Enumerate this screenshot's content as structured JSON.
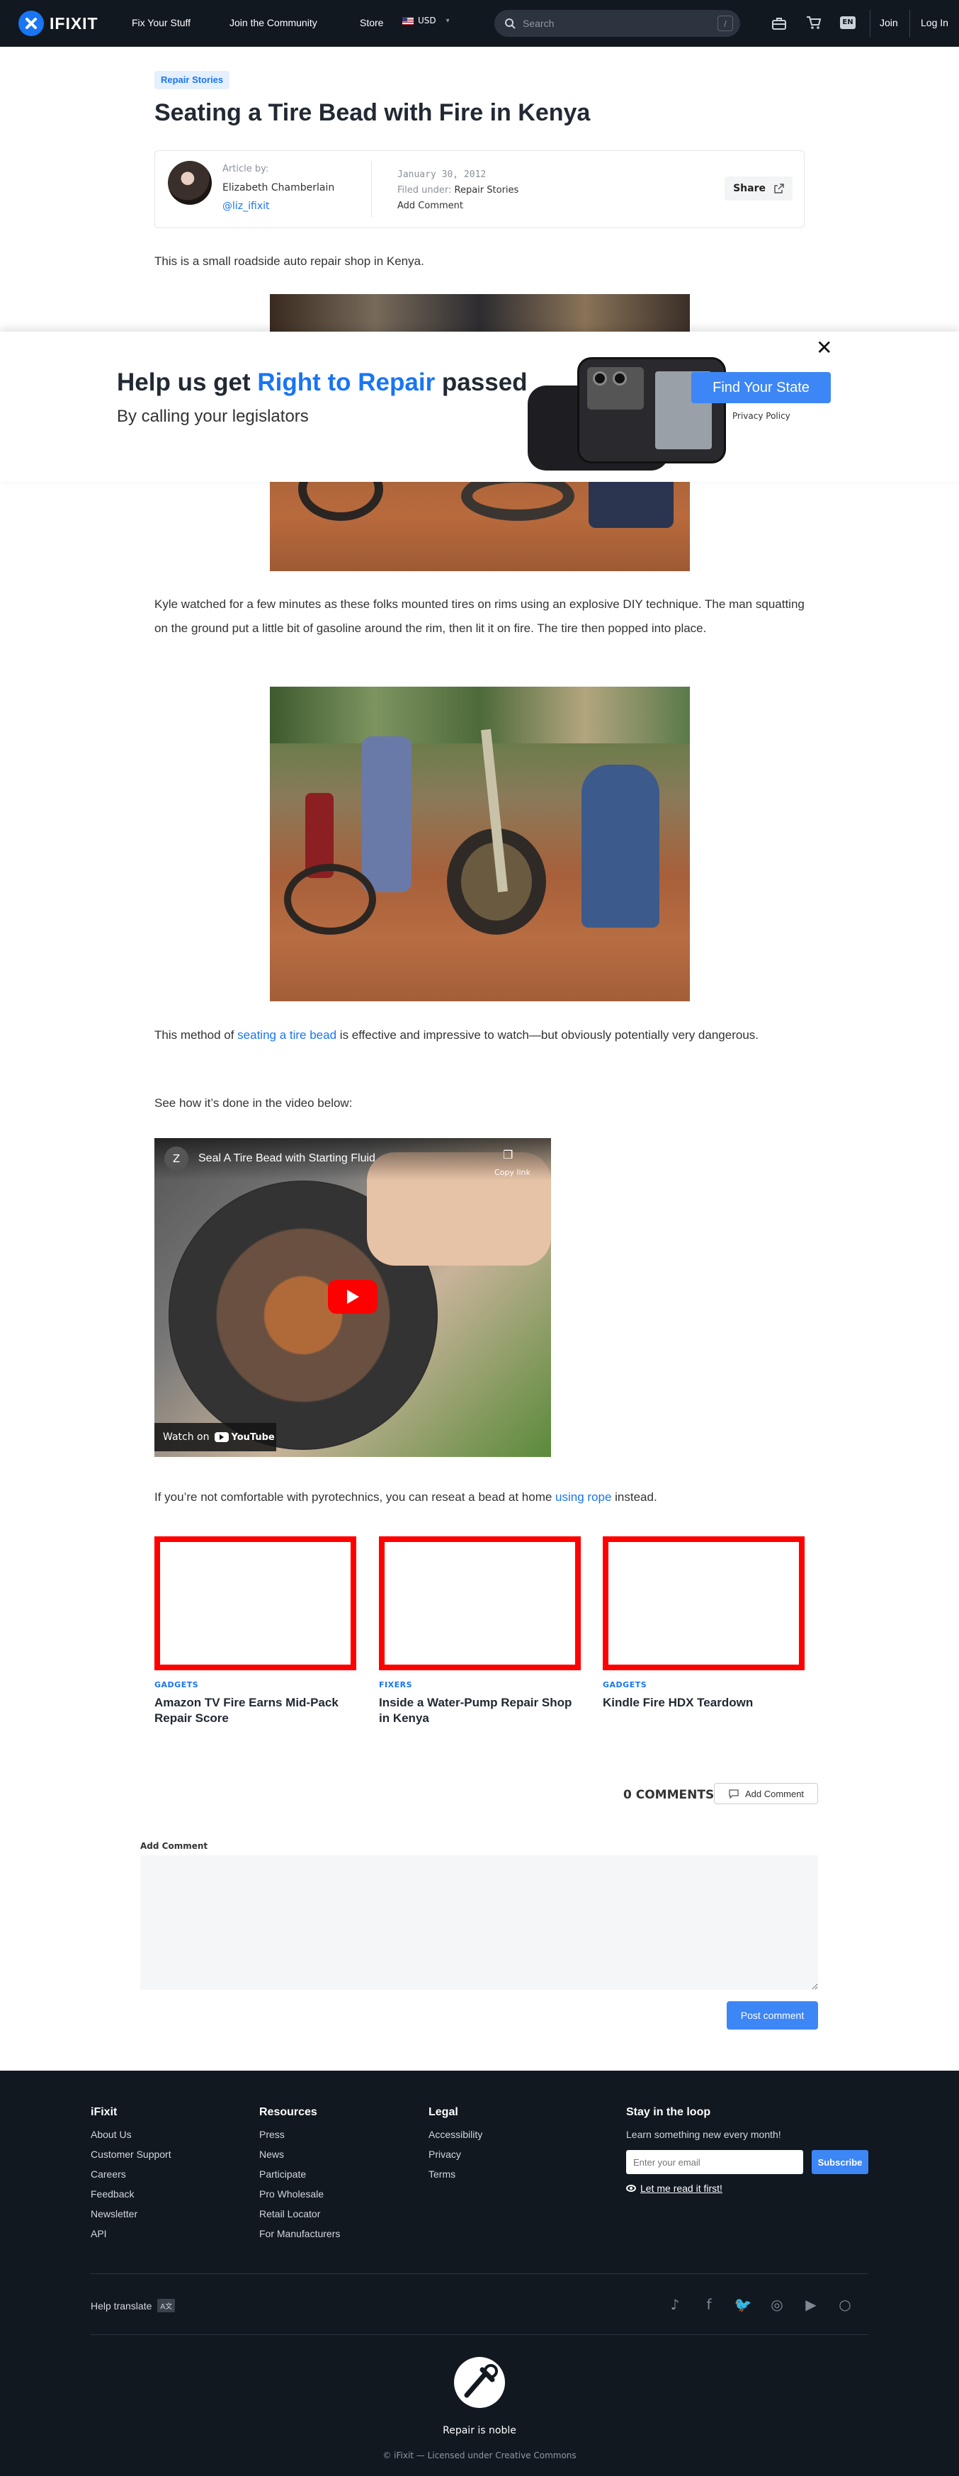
{
  "nav": {
    "brand": "IFIXIT",
    "links": [
      "Fix Your Stuff",
      "Join the Community",
      "Store"
    ],
    "currency": "USD",
    "search_placeholder": "Search",
    "search_shortcut": "/",
    "lang": "EN",
    "join": "Join",
    "login": "Log In"
  },
  "article": {
    "tag": "Repair Stories",
    "title": "Seating a Tire Bead with Fire in Kenya",
    "byline": {
      "article_by": "Article by:",
      "author": "Elizabeth Chamberlain",
      "handle": "@liz_ifixit",
      "date": "January 30, 2012",
      "filed_under_label": "Filed under:",
      "filed_under": "Repair Stories",
      "add_comment": "Add Comment",
      "share": "Share"
    },
    "p1": "This is a small roadside auto repair shop in Kenya.",
    "p2": "Kyle watched for a few minutes as these folks mounted tires on rims using an explosive DIY technique. The man squatting on the ground put a little bit of gasoline around the rim, then lit it on fire. The tire then popped into place.",
    "p3_pre": "This method of ",
    "p3_link": "seating a tire bead",
    "p3_post": " is effective and impressive to watch—but obviously potentially very dangerous.",
    "p4": "See how it’s done in the video below:",
    "p5_pre": "If you’re not comfortable with pyrotechnics, you can reseat a bead at home ",
    "p5_link": "using rope",
    "p5_post": " instead."
  },
  "video": {
    "channel_initial": "Z",
    "title": "Seal A Tire Bead with Starting Fluid",
    "copy_link": "Copy link",
    "watch_on": "Watch on",
    "yt": "YouTube"
  },
  "modal": {
    "title_pre": "Help us get ",
    "title_hl": "Right to Repair",
    "title_post": " passed",
    "subtitle": "By calling your legislators",
    "cta": "Find Your State",
    "privacy": "Privacy Policy"
  },
  "related": [
    {
      "cat": "GADGETS",
      "title": "Amazon TV Fire Earns Mid-Pack Repair Score"
    },
    {
      "cat": "FIXERS",
      "title": "Inside a Water-Pump Repair Shop in Kenya"
    },
    {
      "cat": "GADGETS",
      "title": "Kindle Fire HDX Teardown"
    }
  ],
  "comments": {
    "count": "0 COMMENTS",
    "add_btn": "Add Comment",
    "label": "Add Comment",
    "post": "Post comment"
  },
  "footer": {
    "col1": {
      "head": "iFixit",
      "items": [
        "About Us",
        "Customer Support",
        "Careers",
        "Feedback",
        "Newsletter",
        "API"
      ]
    },
    "col2": {
      "head": "Resources",
      "items": [
        "Press",
        "News",
        "Participate",
        "Pro Wholesale",
        "Retail Locator",
        "For Manufacturers"
      ]
    },
    "col3": {
      "head": "Legal",
      "items": [
        "Accessibility",
        "Privacy",
        "Terms"
      ]
    },
    "newsletter": {
      "head": "Stay in the loop",
      "text": "Learn something new every month!",
      "placeholder": "Enter your email",
      "button": "Subscribe",
      "readfirst": "Let me read it first!"
    },
    "help_translate": "Help translate",
    "motto": "Repair is noble",
    "license": "© iFixit — Licensed under Creative Commons"
  }
}
